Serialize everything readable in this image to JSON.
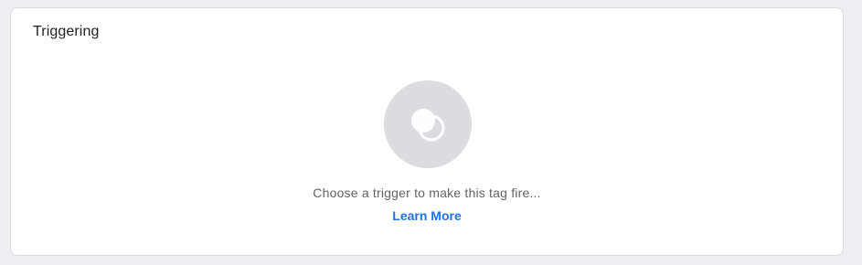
{
  "card": {
    "title": "Triggering",
    "empty_state": {
      "icon": "trigger-icon",
      "message": "Choose a trigger to make this tag fire...",
      "link_label": "Learn More"
    }
  },
  "colors": {
    "background": "#eceef1",
    "card": "#ffffff",
    "icon_circle": "#dadce0",
    "link": "#1a73e8",
    "text_secondary": "#5f6368"
  }
}
